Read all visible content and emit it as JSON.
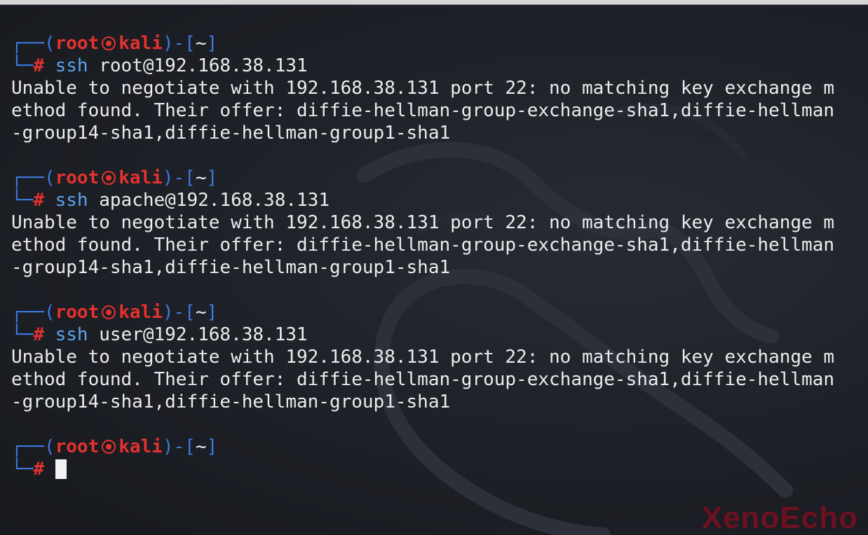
{
  "prompt": {
    "user": "root",
    "host": "kali",
    "cwd": "~",
    "symbol": "#",
    "box_top": "┌──(",
    "box_mid": ")-[",
    "box_end": "]",
    "box_bottom": "└─"
  },
  "sessions": [
    {
      "command": "ssh",
      "args": "root@192.168.38.131",
      "output": [
        "Unable to negotiate with 192.168.38.131 port 22: no matching key exchange m",
        "ethod found. Their offer: diffie-hellman-group-exchange-sha1,diffie-hellman",
        "-group14-sha1,diffie-hellman-group1-sha1"
      ]
    },
    {
      "command": "ssh",
      "args": "apache@192.168.38.131",
      "output": [
        "Unable to negotiate with 192.168.38.131 port 22: no matching key exchange m",
        "ethod found. Their offer: diffie-hellman-group-exchange-sha1,diffie-hellman",
        "-group14-sha1,diffie-hellman-group1-sha1"
      ]
    },
    {
      "command": "ssh",
      "args": "user@192.168.38.131",
      "output": [
        "Unable to negotiate with 192.168.38.131 port 22: no matching key exchange m",
        "ethod found. Their offer: diffie-hellman-group-exchange-sha1,diffie-hellman",
        "-group14-sha1,diffie-hellman-group1-sha1"
      ]
    }
  ],
  "watermark": "XenoEcho",
  "colors": {
    "background": "#1d2026",
    "prompt_box": "#3d79e0",
    "prompt_user": "#e3322f",
    "command": "#5aa3f0",
    "text": "#ececec",
    "watermark": "#6b1222"
  }
}
